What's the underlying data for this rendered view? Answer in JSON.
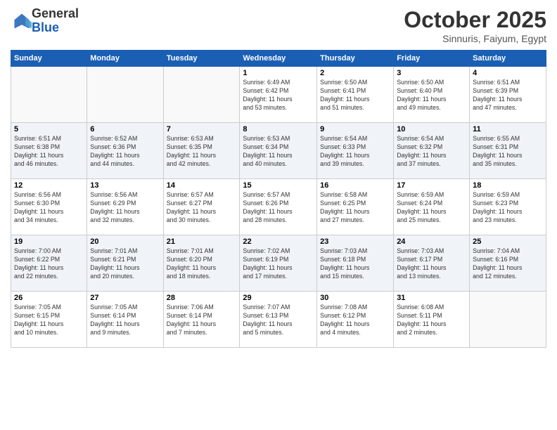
{
  "logo": {
    "line1": "General",
    "line2": "Blue"
  },
  "title": "October 2025",
  "location": "Sinnuris, Faiyum, Egypt",
  "days_header": [
    "Sunday",
    "Monday",
    "Tuesday",
    "Wednesday",
    "Thursday",
    "Friday",
    "Saturday"
  ],
  "weeks": [
    [
      {
        "num": "",
        "info": ""
      },
      {
        "num": "",
        "info": ""
      },
      {
        "num": "",
        "info": ""
      },
      {
        "num": "1",
        "info": "Sunrise: 6:49 AM\nSunset: 6:42 PM\nDaylight: 11 hours\nand 53 minutes."
      },
      {
        "num": "2",
        "info": "Sunrise: 6:50 AM\nSunset: 6:41 PM\nDaylight: 11 hours\nand 51 minutes."
      },
      {
        "num": "3",
        "info": "Sunrise: 6:50 AM\nSunset: 6:40 PM\nDaylight: 11 hours\nand 49 minutes."
      },
      {
        "num": "4",
        "info": "Sunrise: 6:51 AM\nSunset: 6:39 PM\nDaylight: 11 hours\nand 47 minutes."
      }
    ],
    [
      {
        "num": "5",
        "info": "Sunrise: 6:51 AM\nSunset: 6:38 PM\nDaylight: 11 hours\nand 46 minutes."
      },
      {
        "num": "6",
        "info": "Sunrise: 6:52 AM\nSunset: 6:36 PM\nDaylight: 11 hours\nand 44 minutes."
      },
      {
        "num": "7",
        "info": "Sunrise: 6:53 AM\nSunset: 6:35 PM\nDaylight: 11 hours\nand 42 minutes."
      },
      {
        "num": "8",
        "info": "Sunrise: 6:53 AM\nSunset: 6:34 PM\nDaylight: 11 hours\nand 40 minutes."
      },
      {
        "num": "9",
        "info": "Sunrise: 6:54 AM\nSunset: 6:33 PM\nDaylight: 11 hours\nand 39 minutes."
      },
      {
        "num": "10",
        "info": "Sunrise: 6:54 AM\nSunset: 6:32 PM\nDaylight: 11 hours\nand 37 minutes."
      },
      {
        "num": "11",
        "info": "Sunrise: 6:55 AM\nSunset: 6:31 PM\nDaylight: 11 hours\nand 35 minutes."
      }
    ],
    [
      {
        "num": "12",
        "info": "Sunrise: 6:56 AM\nSunset: 6:30 PM\nDaylight: 11 hours\nand 34 minutes."
      },
      {
        "num": "13",
        "info": "Sunrise: 6:56 AM\nSunset: 6:29 PM\nDaylight: 11 hours\nand 32 minutes."
      },
      {
        "num": "14",
        "info": "Sunrise: 6:57 AM\nSunset: 6:27 PM\nDaylight: 11 hours\nand 30 minutes."
      },
      {
        "num": "15",
        "info": "Sunrise: 6:57 AM\nSunset: 6:26 PM\nDaylight: 11 hours\nand 28 minutes."
      },
      {
        "num": "16",
        "info": "Sunrise: 6:58 AM\nSunset: 6:25 PM\nDaylight: 11 hours\nand 27 minutes."
      },
      {
        "num": "17",
        "info": "Sunrise: 6:59 AM\nSunset: 6:24 PM\nDaylight: 11 hours\nand 25 minutes."
      },
      {
        "num": "18",
        "info": "Sunrise: 6:59 AM\nSunset: 6:23 PM\nDaylight: 11 hours\nand 23 minutes."
      }
    ],
    [
      {
        "num": "19",
        "info": "Sunrise: 7:00 AM\nSunset: 6:22 PM\nDaylight: 11 hours\nand 22 minutes."
      },
      {
        "num": "20",
        "info": "Sunrise: 7:01 AM\nSunset: 6:21 PM\nDaylight: 11 hours\nand 20 minutes."
      },
      {
        "num": "21",
        "info": "Sunrise: 7:01 AM\nSunset: 6:20 PM\nDaylight: 11 hours\nand 18 minutes."
      },
      {
        "num": "22",
        "info": "Sunrise: 7:02 AM\nSunset: 6:19 PM\nDaylight: 11 hours\nand 17 minutes."
      },
      {
        "num": "23",
        "info": "Sunrise: 7:03 AM\nSunset: 6:18 PM\nDaylight: 11 hours\nand 15 minutes."
      },
      {
        "num": "24",
        "info": "Sunrise: 7:03 AM\nSunset: 6:17 PM\nDaylight: 11 hours\nand 13 minutes."
      },
      {
        "num": "25",
        "info": "Sunrise: 7:04 AM\nSunset: 6:16 PM\nDaylight: 11 hours\nand 12 minutes."
      }
    ],
    [
      {
        "num": "26",
        "info": "Sunrise: 7:05 AM\nSunset: 6:15 PM\nDaylight: 11 hours\nand 10 minutes."
      },
      {
        "num": "27",
        "info": "Sunrise: 7:05 AM\nSunset: 6:14 PM\nDaylight: 11 hours\nand 9 minutes."
      },
      {
        "num": "28",
        "info": "Sunrise: 7:06 AM\nSunset: 6:14 PM\nDaylight: 11 hours\nand 7 minutes."
      },
      {
        "num": "29",
        "info": "Sunrise: 7:07 AM\nSunset: 6:13 PM\nDaylight: 11 hours\nand 5 minutes."
      },
      {
        "num": "30",
        "info": "Sunrise: 7:08 AM\nSunset: 6:12 PM\nDaylight: 11 hours\nand 4 minutes."
      },
      {
        "num": "31",
        "info": "Sunrise: 6:08 AM\nSunset: 5:11 PM\nDaylight: 11 hours\nand 2 minutes."
      },
      {
        "num": "",
        "info": ""
      }
    ]
  ]
}
